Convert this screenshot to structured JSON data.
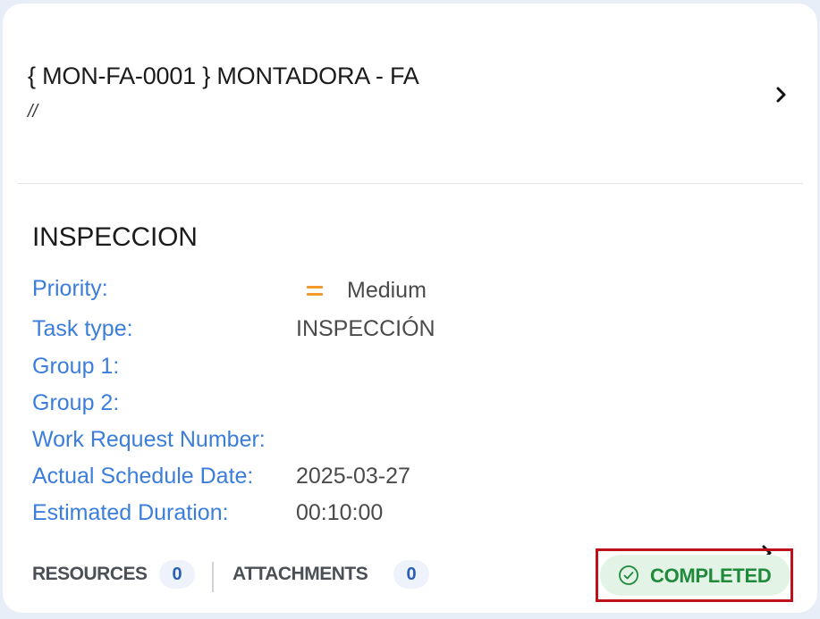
{
  "asset": {
    "title": "{ MON-FA-0001 } MONTADORA - FA",
    "subtitle": "//"
  },
  "task": {
    "title": "INSPECCION",
    "fields": [
      {
        "label": "Priority:",
        "value": "Medium"
      },
      {
        "label": "Task type:",
        "value": "INSPECCIÓN"
      },
      {
        "label": "Group 1:",
        "value": ""
      },
      {
        "label": "Group 2:",
        "value": ""
      },
      {
        "label": "Work Request Number:",
        "value": ""
      },
      {
        "label": "Actual Schedule Date:",
        "value": "2025-03-27"
      },
      {
        "label": "Estimated Duration:",
        "value": "00:10:00"
      }
    ]
  },
  "footer": {
    "resources_label": "RESOURCES",
    "resources_count": "0",
    "attachments_label": "ATTACHMENTS",
    "attachments_count": "0",
    "status": "COMPLETED"
  },
  "colors": {
    "label_blue": "#3b7ddb",
    "priority_medium": "#f39a2d",
    "status_green": "#1f8a3c",
    "status_bg": "#e3f4e6",
    "highlight_red": "#c0101a"
  },
  "icons": {
    "chevron": "chevron-right-icon",
    "priority": "priority-medium-icon",
    "status": "check-circle-icon"
  }
}
